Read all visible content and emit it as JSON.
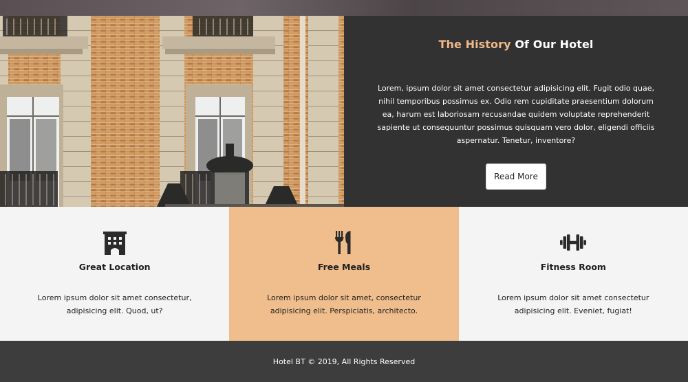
{
  "hero": {
    "title_accent": "The History",
    "title_rest": " Of Our Hotel",
    "body": "Lorem, ipsum dolor sit amet consectetur adipisicing elit. Fugit odio quae, nihil temporibus possimus ex. Odio rem cupiditate praesentium dolorum ea, harum est laboriosam recusandae quidem voluptate reprehenderit sapiente ut consequuntur possimus quisquam vero dolor, eligendi officiis aspernatur. Tenetur, inventore?",
    "button_label": "Read More",
    "accent_color": "#f0b98a",
    "panel_color": "#333232"
  },
  "features": [
    {
      "icon": "hotel-building-icon",
      "title": "Great Location",
      "description": "Lorem ipsum dolor sit amet consectetur, adipisicing elit. Quod, ut?"
    },
    {
      "icon": "utensils-icon",
      "title": "Free Meals",
      "description": "Lorem ipsum dolor sit amet, consectetur adipisicing elit. Perspiciatis, architecto."
    },
    {
      "icon": "dumbbell-icon",
      "title": "Fitness Room",
      "description": "Lorem ipsum dolor sit amet consectetur adipisicing elit. Eveniet, fugiat!"
    }
  ],
  "colors": {
    "peach": "#f0bd8c",
    "light_bg": "#f4f4f4",
    "footer_bg": "#3d3d3d"
  },
  "footer": {
    "text": "Hotel BT © 2019, All Rights Reserved"
  }
}
